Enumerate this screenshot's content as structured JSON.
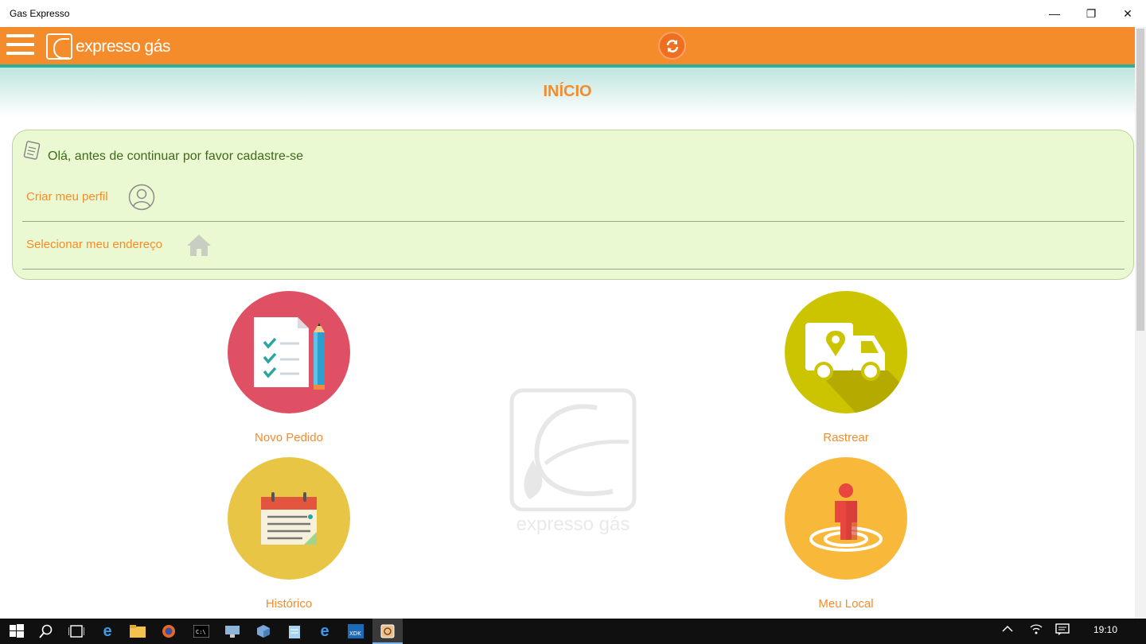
{
  "window": {
    "title": "Gas Expresso",
    "minimize": "—",
    "restore": "❐",
    "close": "✕"
  },
  "header": {
    "brand": "expresso gás",
    "menu_icon": "hamburger-icon",
    "refresh_icon": "refresh-icon",
    "accent": "#f58c2b",
    "line_color": "#2fae97"
  },
  "page": {
    "title": "INÍCIO"
  },
  "register_card": {
    "message": "Olá, antes de continuar por favor cadastre-se",
    "create_profile": "Criar meu perfil",
    "select_address": "Selecionar meu endereço",
    "background": "#ebf9d2"
  },
  "watermark": {
    "text": "expresso gás"
  },
  "tiles": [
    {
      "label": "Novo Pedido",
      "icon": "order-checklist-icon",
      "color": "#e05064"
    },
    {
      "label": "Rastrear",
      "icon": "delivery-truck-icon",
      "color": "#cdc400"
    },
    {
      "label": "Histórico",
      "icon": "calendar-icon",
      "color": "#e8c545"
    },
    {
      "label": "Meu Local",
      "icon": "location-person-icon",
      "color": "#f8b93b"
    }
  ],
  "taskbar": {
    "clock": "19:10",
    "icons": [
      "windows-start-icon",
      "search-icon",
      "task-view-icon",
      "edge-icon",
      "file-explorer-icon",
      "firefox-icon",
      "cmd-icon",
      "network-app-icon",
      "cube-app-icon",
      "notepad-icon",
      "ie-icon",
      "xdk-icon",
      "gas-expresso-app-icon"
    ]
  }
}
